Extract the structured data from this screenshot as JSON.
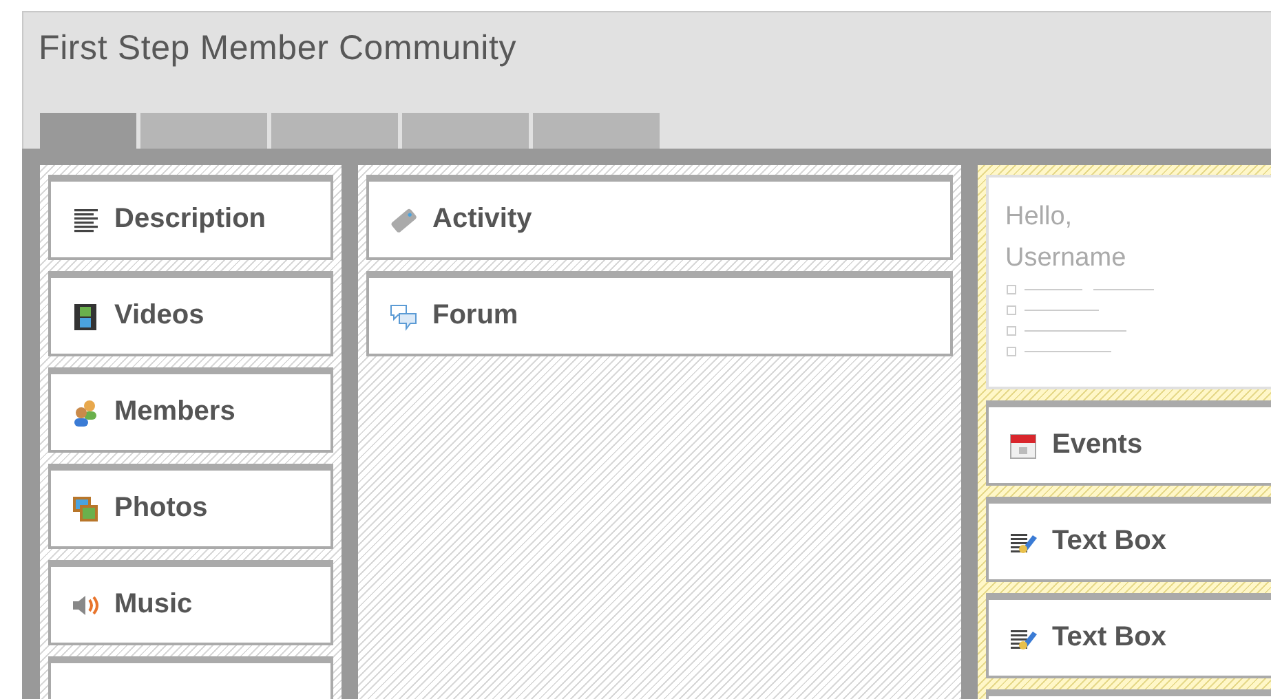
{
  "header": {
    "title": "First Step Member Community"
  },
  "tabs": [
    {
      "selected": true
    },
    {
      "selected": false
    },
    {
      "selected": false
    },
    {
      "selected": false
    },
    {
      "selected": false
    }
  ],
  "left_column": [
    {
      "kind": "description",
      "label": "Description"
    },
    {
      "kind": "videos",
      "label": "Videos"
    },
    {
      "kind": "members",
      "label": "Members"
    },
    {
      "kind": "photos",
      "label": "Photos"
    },
    {
      "kind": "music",
      "label": "Music"
    }
  ],
  "middle_column": [
    {
      "kind": "activity",
      "label": "Activity"
    },
    {
      "kind": "forum",
      "label": "Forum"
    }
  ],
  "welcome": {
    "greeting": "Hello,",
    "name": "Username"
  },
  "right_column": [
    {
      "kind": "events",
      "label": "Events"
    },
    {
      "kind": "textbox",
      "label": "Text Box"
    },
    {
      "kind": "textbox",
      "label": "Text Box"
    }
  ]
}
